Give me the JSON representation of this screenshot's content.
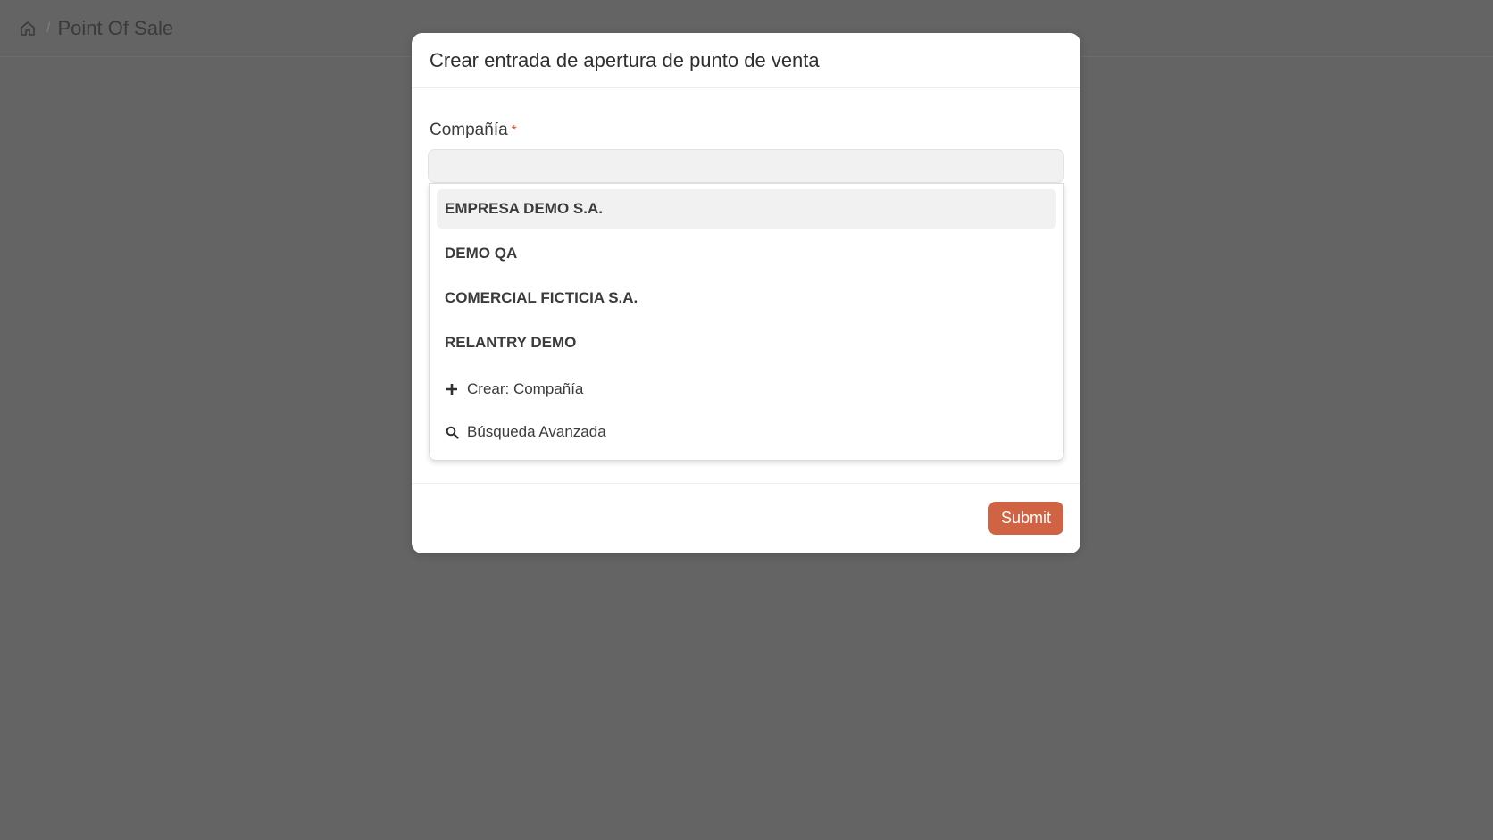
{
  "breadcrumb": {
    "home_icon": "home-icon",
    "separator": "/",
    "title": "Point Of Sale"
  },
  "modal": {
    "title": "Crear entrada de apertura de punto de venta",
    "company_field": {
      "label": "Compañía",
      "required_mark": "*",
      "value": ""
    },
    "dropdown": {
      "options": [
        "EMPRESA DEMO S.A.",
        "DEMO QA",
        "COMERCIAL FICTICIA S.A.",
        "RELANTRY DEMO"
      ],
      "create_action": {
        "icon": "plus-icon",
        "label": "Crear: Compañía"
      },
      "search_action": {
        "icon": "search-icon",
        "label": "Búsqueda Avanzada"
      }
    },
    "submit_label": "Submit"
  },
  "colors": {
    "overlay": "#646464",
    "accent": "#cf6343",
    "required": "#e0533a"
  }
}
